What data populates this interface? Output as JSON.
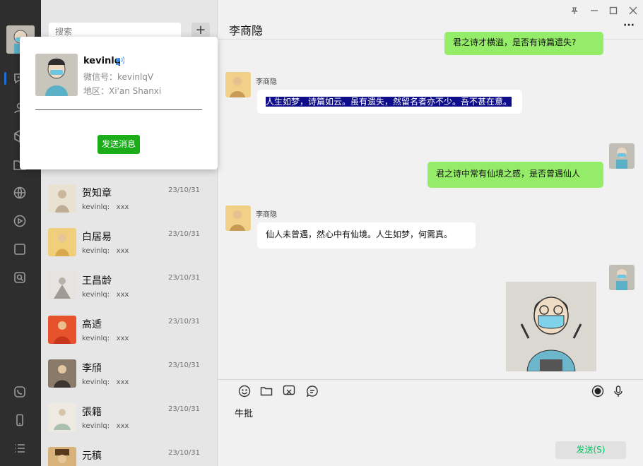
{
  "colors": {
    "accent": "#07c160",
    "bubble_self": "#95ec69",
    "popup_button": "#1aad19",
    "rail_bg": "#2e2e2e",
    "selection": "#0e0e8a"
  },
  "sidebar": {
    "icons": [
      "chat-icon",
      "contacts-icon",
      "favorites-icon",
      "files-icon",
      "moments-icon",
      "channels-icon",
      "mini-programs-icon",
      "search-icon",
      "phone-icon",
      "mobile-icon",
      "menu-icon"
    ]
  },
  "search": {
    "placeholder": "搜索",
    "add_label": "+"
  },
  "contacts": [
    {
      "name": "贺知章",
      "time": "23/10/31",
      "preview": "kevinlq:   xxx"
    },
    {
      "name": "白居易",
      "time": "23/10/31",
      "preview": "kevinlq:   xxx"
    },
    {
      "name": "王昌龄",
      "time": "23/10/31",
      "preview": "kevinlq:   xxx"
    },
    {
      "name": "高适",
      "time": "23/10/31",
      "preview": "kevinlq:   xxx"
    },
    {
      "name": "李頎",
      "time": "23/10/31",
      "preview": "kevinlq:   xxx"
    },
    {
      "name": "張籍",
      "time": "23/10/31",
      "preview": "kevinlq:   xxx"
    },
    {
      "name": "元稹",
      "time": "23/10/31",
      "preview": ""
    }
  ],
  "chat": {
    "title": "李商隐",
    "more": "···",
    "messages": [
      {
        "from": "self",
        "text": "君之诗才横溢，是否有诗篇遗失?"
      },
      {
        "from": "other",
        "sender": "李商隐",
        "text": "人生如梦，诗篇如云。虽有遗失，然留名者亦不少。吾不甚在意。",
        "selected": true
      },
      {
        "from": "self",
        "text": "君之诗中常有仙境之感，是否曾遇仙人"
      },
      {
        "from": "other",
        "sender": "李商隐",
        "text": "仙人未曾遇，然心中有仙境。人生如梦，何需真。"
      },
      {
        "from": "self",
        "type": "image"
      }
    ],
    "input_value": "牛批",
    "send_label": "发送(S)"
  },
  "profile_popup": {
    "name": "kevinlq",
    "wechat_id": "微信号：kevinlqV",
    "region": "地区：Xi'an Shanxi",
    "send_message_label": "发送消息"
  }
}
